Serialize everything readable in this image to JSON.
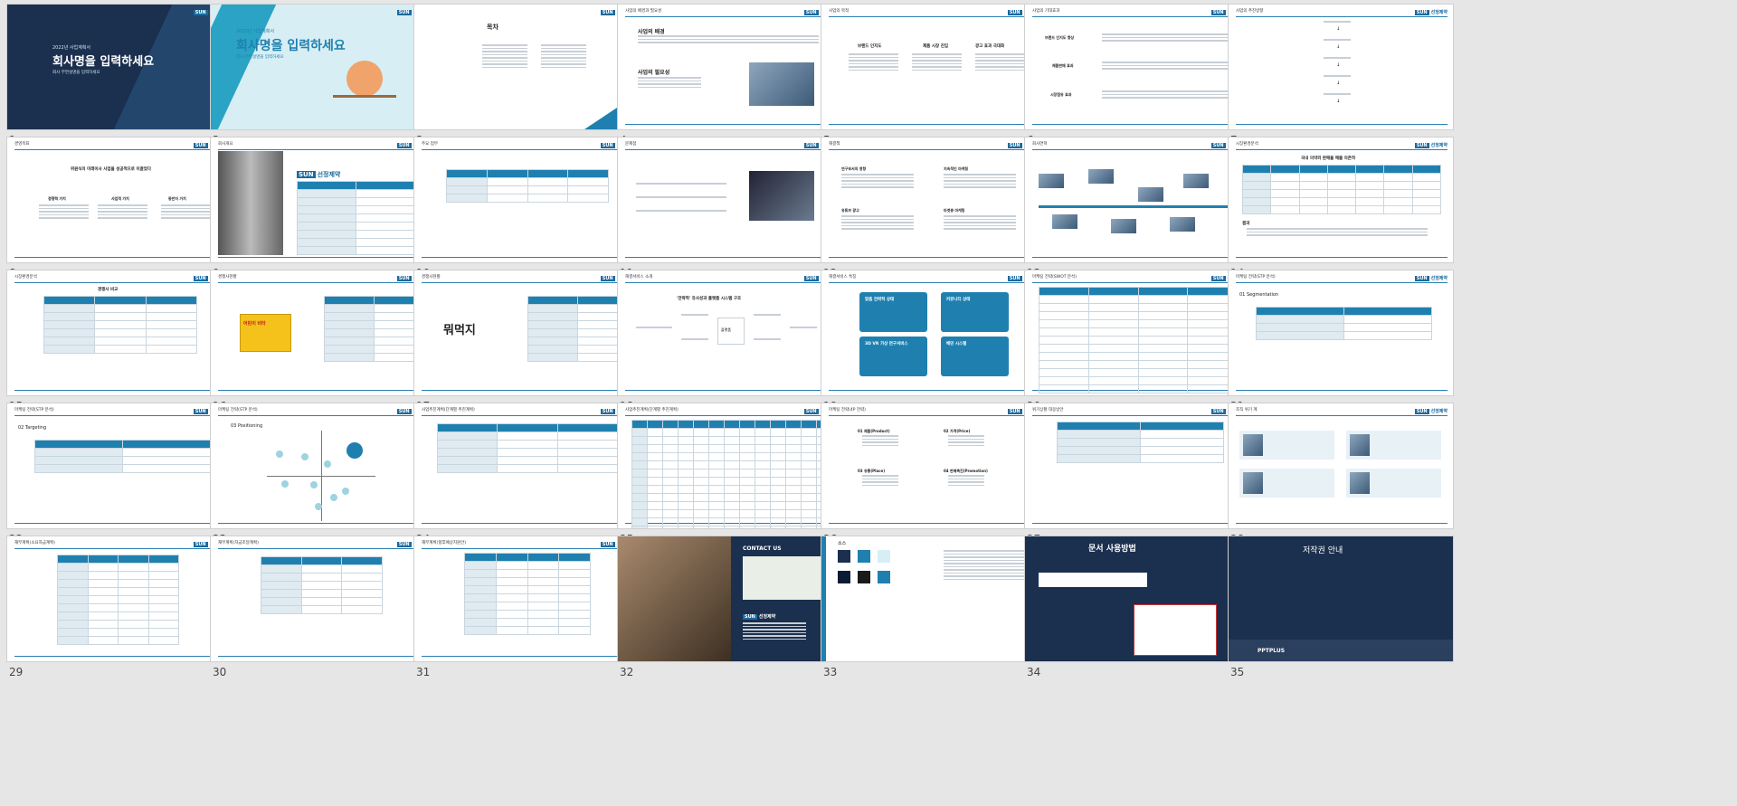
{
  "slide_numbers": [
    "1",
    "2",
    "3",
    "4",
    "5",
    "6",
    "7",
    "8",
    "9",
    "10",
    "11",
    "12",
    "13",
    "14",
    "15",
    "16",
    "17",
    "18",
    "19",
    "20",
    "21",
    "22",
    "23",
    "24",
    "25",
    "26",
    "27",
    "28",
    "29",
    "30",
    "31",
    "32",
    "33",
    "34",
    "35"
  ],
  "brand": {
    "box": "SUN",
    "name": "선정제약"
  },
  "slides": {
    "s1": {
      "kicker": "2022년 사업계획서",
      "title": "회사명을 입력하세요",
      "sub": "회사 부연설명을 입력하세요"
    },
    "s2": {
      "kicker": "2022년 사업계획서",
      "title": "회사명을 입력하세요",
      "sub": "회사 부연설명을 입력하세요"
    },
    "s3": {
      "title": "목차"
    },
    "s4": {
      "header": "사업의 배경과 필요성",
      "h1": "사업의 배경",
      "h2": "사업의 필요성"
    },
    "s5": {
      "header": "사업의 목적",
      "cols": [
        "브랜드 인지도",
        "제품 시장 진입",
        "광고 효과 극대화"
      ]
    },
    "s6": {
      "header": "사업의 기대효과",
      "rows": [
        "브랜드 인지도 향상",
        "제품판매 효과",
        "시장점유 효과"
      ]
    },
    "s7": {
      "header": "사업의 추진방향"
    },
    "s8": {
      "header": "경영목표",
      "title": "위원식의 미래이사 사업을 성공적으로 이끌었다",
      "cols": [
        "경쟁력 가치",
        "사업적 가치",
        "동반자 가치"
      ]
    },
    "s9": {
      "header": "회사개요"
    },
    "s10": {
      "header": "주요 업무"
    },
    "s11": {
      "header": "문제점"
    },
    "s12": {
      "header": "해결책",
      "items": [
        "연구부서의 영향",
        "지속적인 마케팅",
        "유튜브 광고",
        "타겟층 마케팅"
      ]
    },
    "s13": {
      "header": "회사연혁"
    },
    "s14": {
      "header": "시장환경분석",
      "title": "국내 의약외 판매율 매출 의존하",
      "sub": "결과"
    },
    "s15": {
      "header": "시장환경분석",
      "title": "경쟁사 비교"
    },
    "s16": {
      "header": "경쟁사현황",
      "product": "어린이 비타"
    },
    "s17": {
      "header": "경쟁사현황",
      "brand": "뭐먹지"
    },
    "s18": {
      "header": "해결서비스 소개",
      "title": "'전략적' 유사성과 플랫폼 시스템 구조",
      "center": "플랫폼"
    },
    "s19": {
      "header": "해결서비스 특징",
      "tiles": [
        "맞춤 전략적 상태",
        "커뮤니티 상태",
        "3D VR 가상 연구서비스",
        "배민 시스템"
      ]
    },
    "s20": {
      "header": "마케팅 전략(SWOT 분석)"
    },
    "s21": {
      "header": "마케팅 전략(STP 분석)",
      "sub": "01 Segmentation"
    },
    "s22": {
      "header": "마케팅 전략(STP 분석)",
      "sub": "02 Targeting"
    },
    "s23": {
      "header": "마케팅 전략(STP 분석)",
      "sub": "03 Positioning"
    },
    "s24": {
      "header": "사업추진계획(단계별 추진계획)"
    },
    "s25": {
      "header": "사업추진계획(단계별 추진계획)"
    },
    "s26": {
      "header": "마케팅 전략(4P 전략)",
      "items": [
        "01 제품(Product)",
        "02 가격(Price)",
        "03 유통(Place)",
        "04 판매촉진(Promotion)"
      ]
    },
    "s27": {
      "header": "위기상황 대응방안"
    },
    "s28": {
      "header": "조직 위기 계"
    },
    "s29": {
      "header": "재무계획(소요자금계획)"
    },
    "s30": {
      "header": "재무계획(자금조달계획)"
    },
    "s31": {
      "header": "재무계획(향후예상지원안)"
    },
    "s32": {
      "title": "CONTACT US"
    },
    "s33": {
      "label": "소스"
    },
    "s34": {
      "title": "문서 사용방법"
    },
    "s35": {
      "title": "저작권 안내",
      "footer": "PPTPLUS"
    }
  },
  "colors": {
    "navy": "#1b2f4e",
    "blue": "#1f80b0",
    "teal": "#2aa3c4",
    "light": "#d7eef5"
  }
}
